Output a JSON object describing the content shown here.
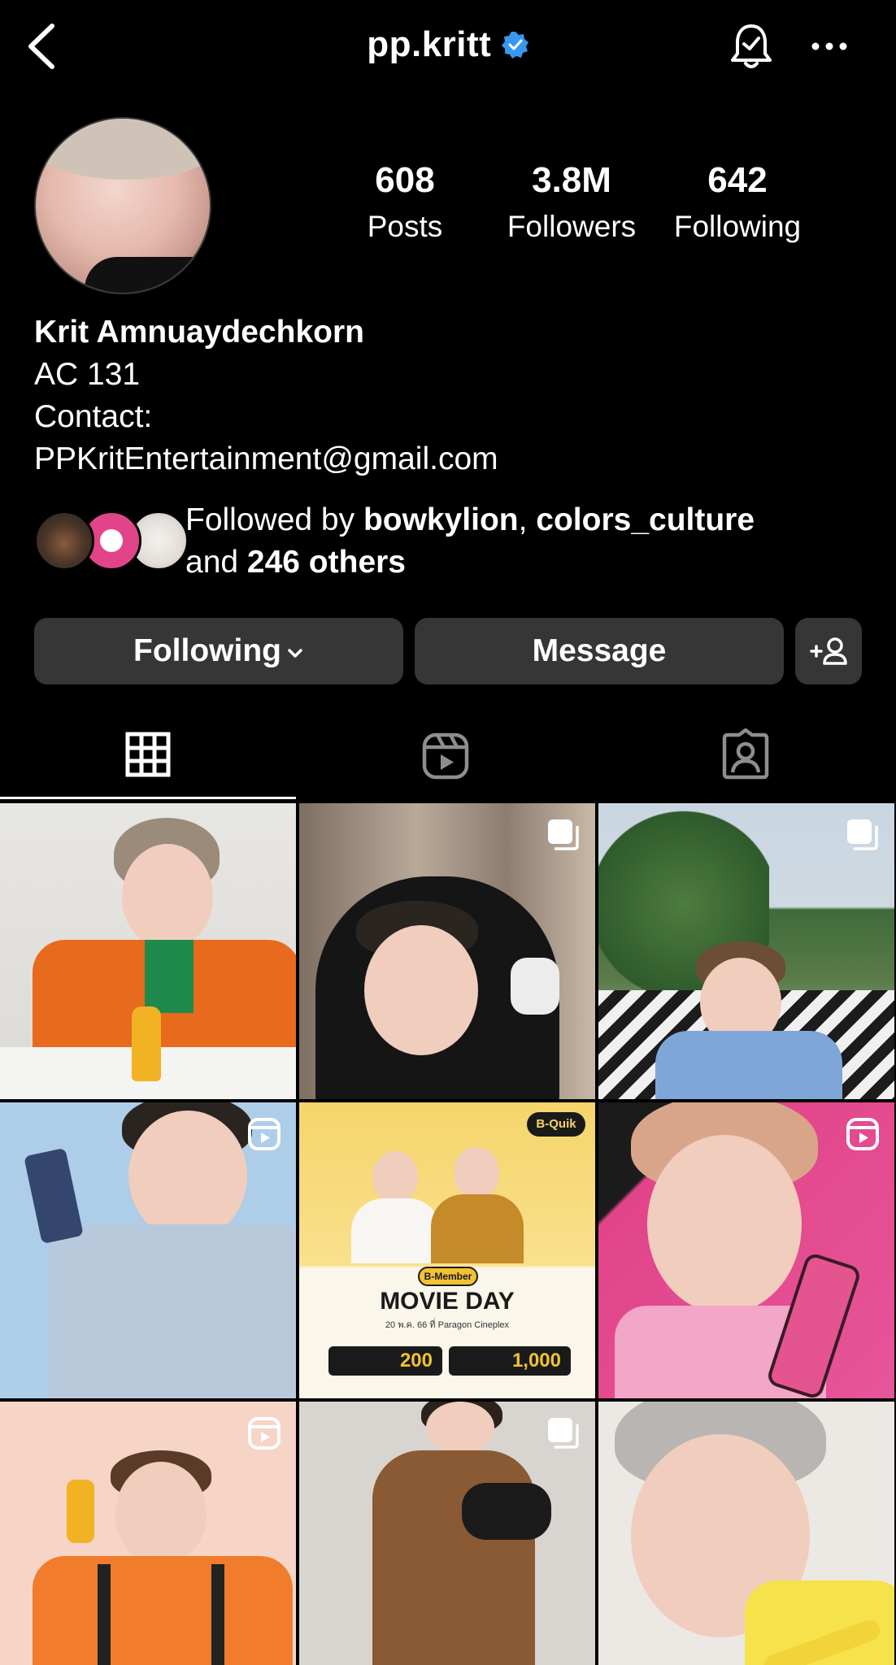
{
  "header": {
    "username": "pp.kritt",
    "icons": [
      "back-icon",
      "verified-icon",
      "bell-icon",
      "more-icon"
    ]
  },
  "profile": {
    "stats": [
      {
        "value": "608",
        "label": "Posts"
      },
      {
        "value": "3.8M",
        "label": "Followers"
      },
      {
        "value": "642",
        "label": "Following"
      }
    ],
    "name": "Krit Amnuaydechkorn",
    "bio_lines": [
      "AC 131",
      "Contact:",
      "PPKritEntertainment@gmail.com"
    ]
  },
  "followed_by": {
    "prefix": "Followed by ",
    "user1": "bowkylion",
    "sep": ", ",
    "user2": "colors_culture",
    "and": "and ",
    "others": "246 others"
  },
  "buttons": {
    "following": "Following",
    "message": "Message",
    "add_person_icon": "add-person-icon"
  },
  "tabs": [
    "grid-tab",
    "reels-tab",
    "tagged-tab"
  ],
  "grid": [
    {
      "type": "photo"
    },
    {
      "type": "carousel"
    },
    {
      "type": "carousel"
    },
    {
      "type": "reel"
    },
    {
      "type": "photo",
      "brand": "B-Quik",
      "badge": "B-Member",
      "headline": "MOVIE DAY",
      "sub": "20 พ.ค. 66 ที่ Paragon Cineplex",
      "promo1": "200",
      "promo2": "1,000"
    },
    {
      "type": "reel"
    },
    {
      "type": "reel"
    },
    {
      "type": "carousel"
    },
    {
      "type": "photo"
    }
  ],
  "colors": {
    "verified": "#3897f0",
    "button_bg": "#363636",
    "accent_pink": "#e24489"
  }
}
